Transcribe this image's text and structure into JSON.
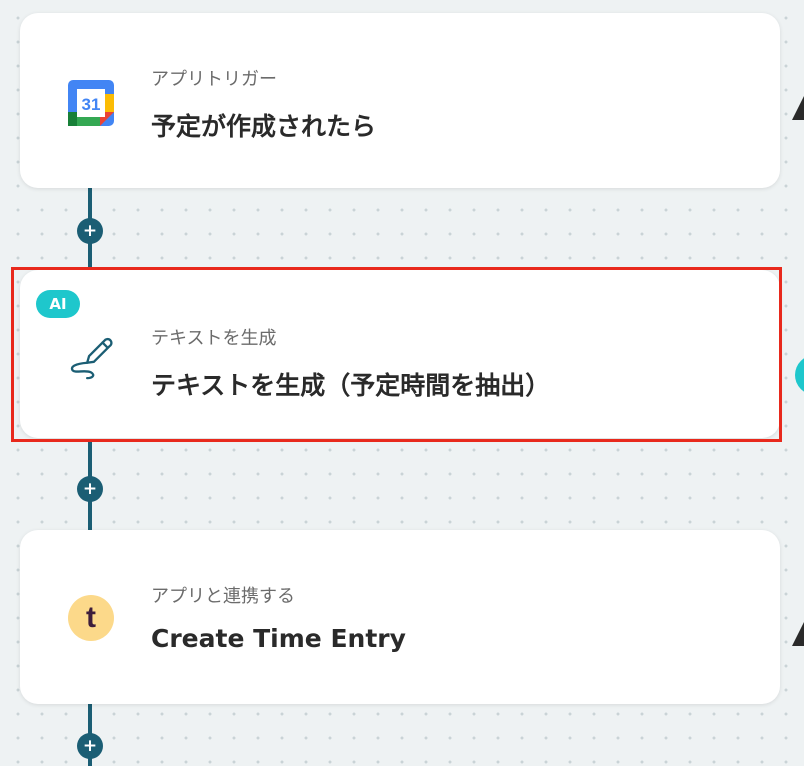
{
  "flow": {
    "steps": [
      {
        "type_label": "アプリトリガー",
        "title": "予定が作成されたら",
        "icon": "google-calendar-icon",
        "icon_text": "31"
      },
      {
        "badge": "AI",
        "type_label": "テキストを生成",
        "title": "テキストを生成（予定時間を抽出）",
        "icon": "pen-write-icon",
        "selected": true
      },
      {
        "type_label": "アプリと連携する",
        "title": "Create Time Entry",
        "icon": "toggl-icon",
        "icon_text": "t"
      }
    ],
    "add_step_symbol": "+"
  },
  "colors": {
    "connector": "#1b5e74",
    "selection_border": "#e8291c",
    "ai_badge": "#1ec7cc",
    "toggl_icon_bg": "#fcd98a",
    "toggl_icon_fg": "#3d1d3b",
    "calendar_blue": "#4285f4"
  }
}
